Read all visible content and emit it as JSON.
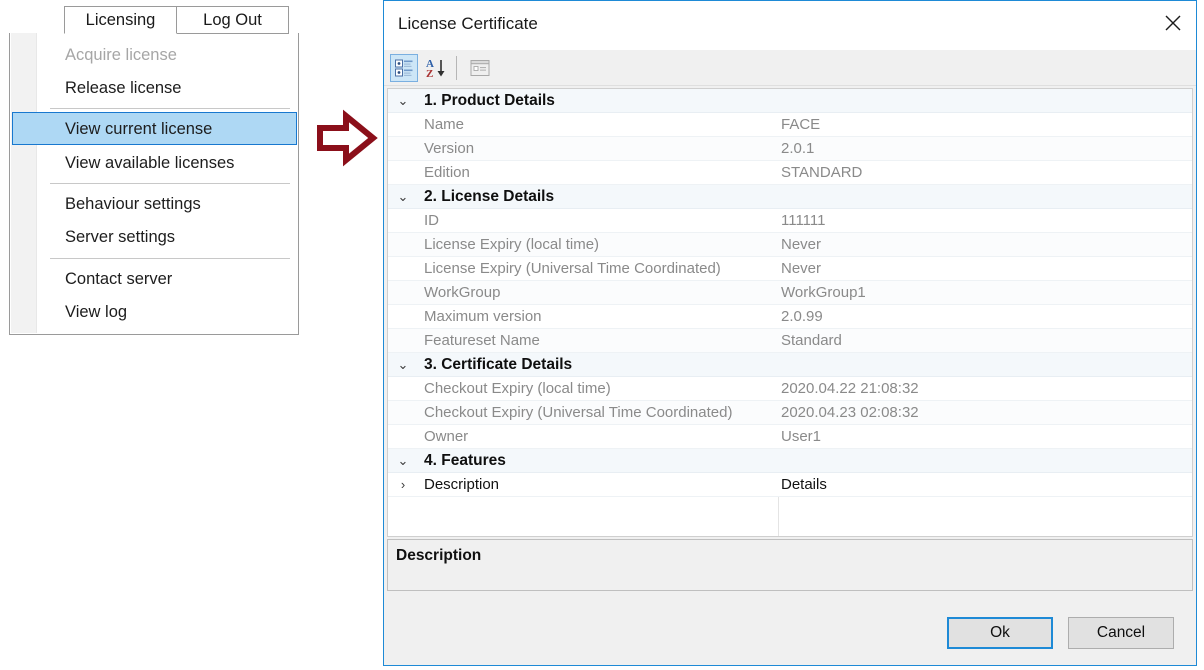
{
  "menu": {
    "tabs": [
      {
        "label": "Licensing",
        "active": true
      },
      {
        "label": "Log Out",
        "active": false
      }
    ],
    "items": [
      {
        "label": "Acquire license",
        "state": "disabled"
      },
      {
        "label": "Release license",
        "state": "normal"
      },
      {
        "label": "View current license",
        "state": "selected"
      },
      {
        "label": "View available licenses",
        "state": "normal"
      },
      {
        "label": "Behaviour settings",
        "state": "normal"
      },
      {
        "label": "Server settings",
        "state": "normal"
      },
      {
        "label": "Contact server",
        "state": "normal"
      },
      {
        "label": "View log",
        "state": "normal"
      }
    ]
  },
  "arrow": {
    "icon": "arrow-right-icon",
    "color": "#8b0f1a"
  },
  "dialog": {
    "title": "License Certificate",
    "close_icon": "close-icon",
    "toolbar": {
      "buttons": [
        {
          "name": "categorized-view-button",
          "icon": "categorized-icon",
          "active": true
        },
        {
          "name": "alphabetical-sort-button",
          "icon": "sort-az-icon",
          "active": false
        },
        {
          "name": "property-pages-button",
          "icon": "property-pages-icon",
          "active": false
        }
      ]
    },
    "grid": {
      "sections": [
        {
          "label": "1. Product Details",
          "expanded": true,
          "twisty": "⌄",
          "rows": [
            {
              "name": "Name",
              "value": "FACE"
            },
            {
              "name": "Version",
              "value": "2.0.1"
            },
            {
              "name": "Edition",
              "value": "STANDARD"
            }
          ]
        },
        {
          "label": "2. License Details",
          "expanded": true,
          "twisty": "⌄",
          "rows": [
            {
              "name": "ID",
              "value": "111111"
            },
            {
              "name": "License Expiry (local time)",
              "value": "Never"
            },
            {
              "name": "License Expiry (Universal Time Coordinated)",
              "value": "Never"
            },
            {
              "name": "WorkGroup",
              "value": "WorkGroup1"
            },
            {
              "name": "Maximum version",
              "value": "2.0.99"
            },
            {
              "name": "Featureset Name",
              "value": "Standard"
            }
          ]
        },
        {
          "label": "3. Certificate Details",
          "expanded": true,
          "twisty": "⌄",
          "rows": [
            {
              "name": "Checkout Expiry (local time)",
              "value": "2020.04.22 21:08:32"
            },
            {
              "name": "Checkout Expiry (Universal Time Coordinated)",
              "value": "2020.04.23 02:08:32"
            },
            {
              "name": "Owner",
              "value": "User1"
            }
          ]
        },
        {
          "label": "4. Features",
          "expanded": true,
          "twisty": "⌄",
          "rows": [
            {
              "name": "Description",
              "value": "Details",
              "twisty": "›",
              "strong": true
            }
          ]
        }
      ]
    },
    "description_pane": {
      "title": "Description",
      "text": ""
    },
    "buttons": {
      "ok": "Ok",
      "cancel": "Cancel"
    }
  }
}
